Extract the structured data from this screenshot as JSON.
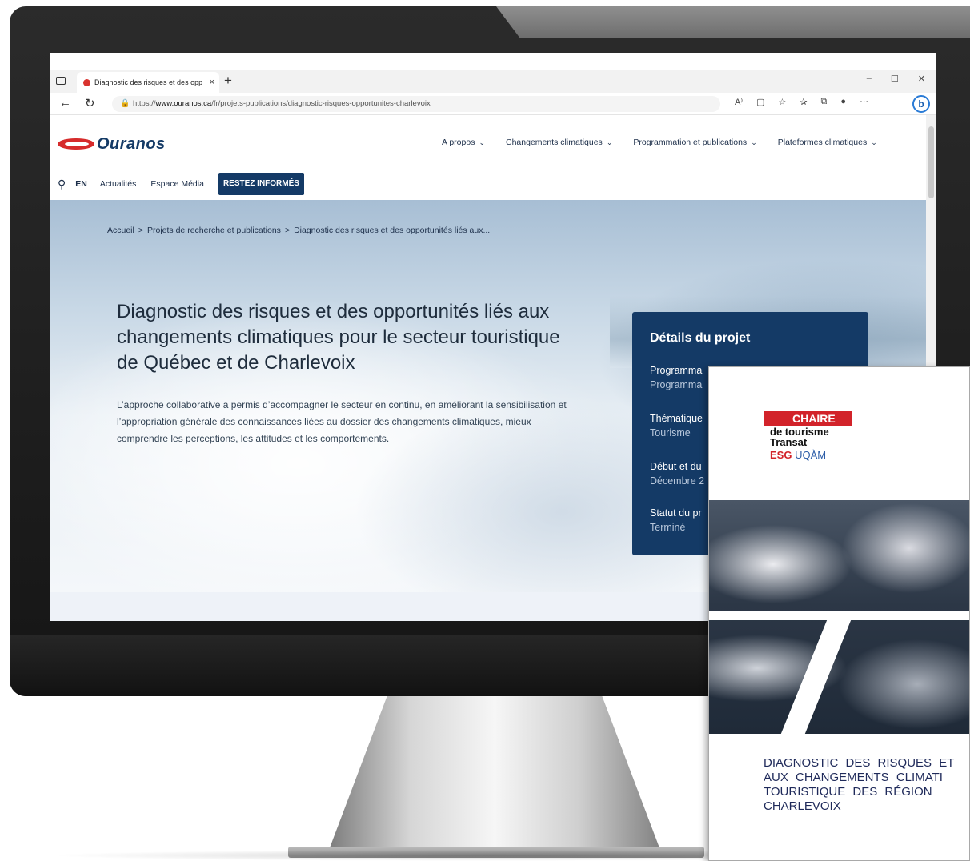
{
  "browser": {
    "tab_title": "Diagnostic des risques et des opp",
    "new_tab_symbol": "+",
    "tab_close_symbol": "×",
    "window_controls": [
      "–",
      "☐",
      "✕"
    ],
    "url_prefix": "https://",
    "url_domain": "www.ouranos.ca",
    "url_path": "/fr/projets-publications/diagnostic-risques-opportunites-charlevoix",
    "nav_back_symbol": "←",
    "nav_reload_symbol": "↻",
    "toolbar_icons": [
      "A⁾",
      "▢",
      "☆",
      "✰",
      "⧉",
      "●",
      "···"
    ],
    "bing_label": "b"
  },
  "site": {
    "logo_text": "Ouranos",
    "main_nav": [
      {
        "label": "A propos"
      },
      {
        "label": "Changements climatiques"
      },
      {
        "label": "Programmation et publications"
      },
      {
        "label": "Plateformes climatiques"
      }
    ],
    "chevron_symbol": "⌄",
    "utility": {
      "search_symbol": "⚲",
      "lang": "EN",
      "link_news": "Actualités",
      "link_media": "Espace Média",
      "cta": "RESTEZ INFORMÉS"
    }
  },
  "breadcrumb": {
    "separator": ">",
    "items": [
      "Accueil",
      "Projets de recherche et publications",
      "Diagnostic des risques et des opportunités liés aux..."
    ]
  },
  "hero": {
    "title": "Diagnostic des risques et des opportunités liés aux changements climatiques pour le secteur touristique de Québec et de Charlevoix",
    "description": "L’approche collaborative a permis d’accompagner le secteur en continu, en améliorant la sensibilisation et l’appropriation générale des connaissances liées au dossier des changements climatiques, mieux comprendre les perceptions, les attitudes et les comportements."
  },
  "details": {
    "title": "Détails du projet",
    "fields": [
      {
        "label": "Programma",
        "value": "Programma"
      },
      {
        "label": "Thématique",
        "value": "Tourisme"
      },
      {
        "label": "Début et du",
        "value": "Décembre 2"
      },
      {
        "label": "Statut du pr",
        "value": "Terminé"
      }
    ]
  },
  "document": {
    "org_bar": "CHAIRE",
    "org_line1": "de tourisme",
    "org_line2": "Transat",
    "org_esg": "ESG",
    "org_uqam": "UQÀM",
    "title_lines": [
      "DIAGNOSTIC DES RISQUES ET",
      "AUX CHANGEMENTS CLIMATI",
      "TOURISTIQUE DES RÉGION",
      "CHARLEVOIX"
    ]
  }
}
